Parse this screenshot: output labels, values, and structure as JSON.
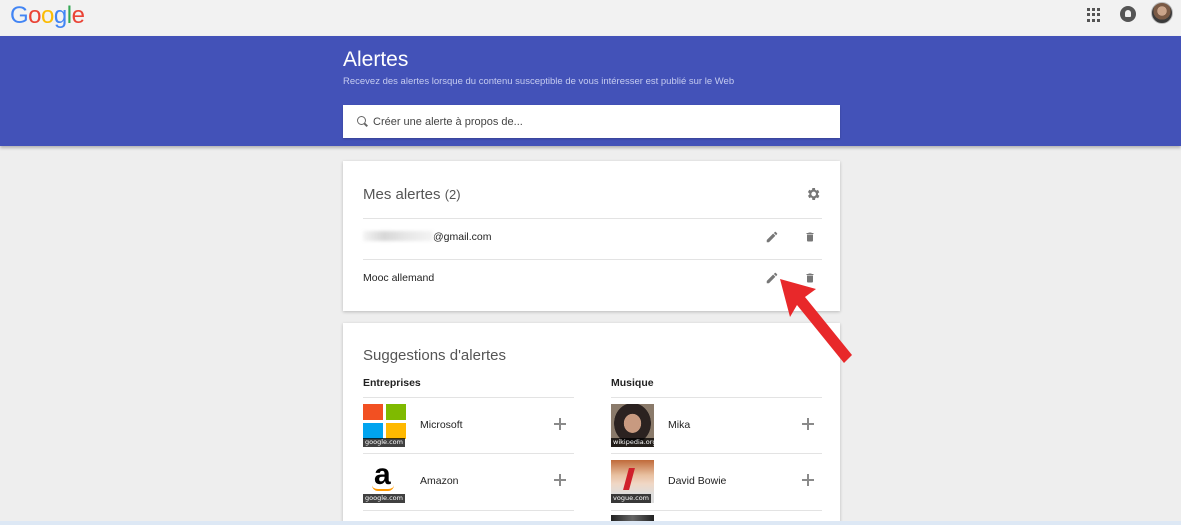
{
  "header": {
    "logo": [
      "G",
      "o",
      "o",
      "g",
      "l",
      "e"
    ],
    "logo_colors": [
      "#4285f4",
      "#ea4335",
      "#fbbc05",
      "#4285f4",
      "#34a853",
      "#ea4335"
    ],
    "icons": [
      "apps-icon",
      "notifications-icon",
      "avatar"
    ]
  },
  "banner": {
    "title": "Alertes",
    "subtitle": "Recevez des alertes lorsque du contenu susceptible de vous intéresser est publié sur le Web",
    "background": "#4352b8",
    "search_placeholder": "Créer une alerte à propos de..."
  },
  "my_alerts": {
    "title": "Mes alertes",
    "count": "(2)",
    "items": [
      {
        "label": "@gmail.com"
      },
      {
        "label": "Mooc allemand"
      }
    ]
  },
  "suggestions": {
    "title": "Suggestions d'alertes",
    "columns": [
      {
        "heading": "Entreprises",
        "items": [
          {
            "name": "Microsoft",
            "source": "google.com"
          },
          {
            "name": "Amazon",
            "source": "google.com"
          }
        ]
      },
      {
        "heading": "Musique",
        "items": [
          {
            "name": "Mika",
            "source": "wikipedia.org"
          },
          {
            "name": "David Bowie",
            "source": "vogue.com"
          }
        ]
      }
    ]
  },
  "annotation": {
    "arrow_color": "#e8282a"
  }
}
